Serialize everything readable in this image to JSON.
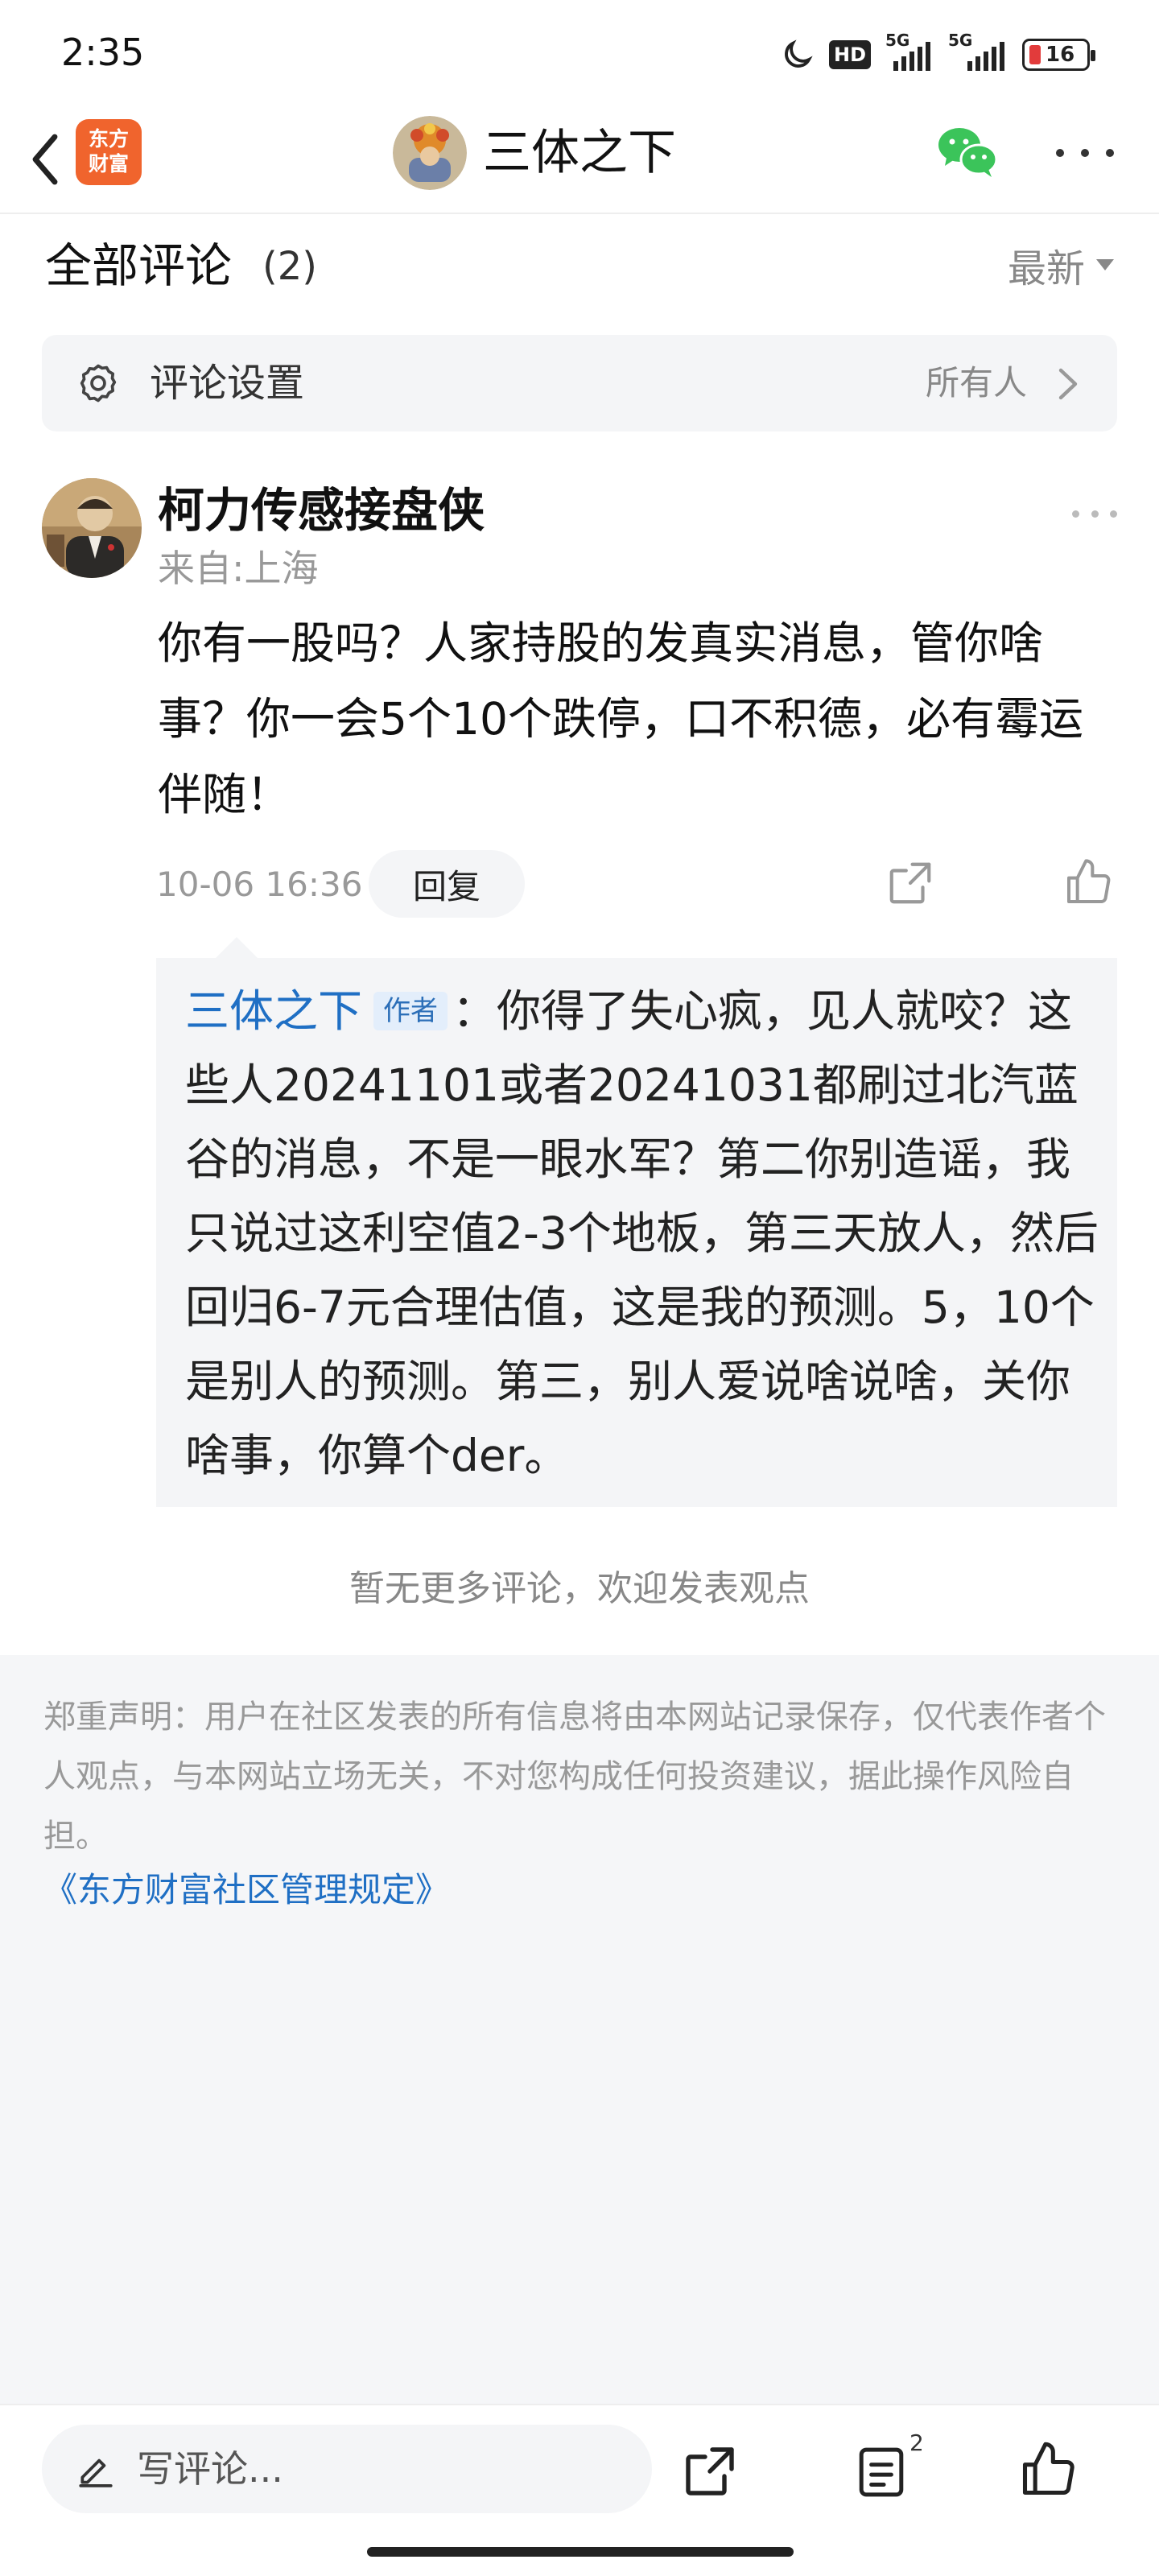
{
  "status_bar": {
    "time": "2:35",
    "hd_label": "HD",
    "net1_label": "5G",
    "net2_label": "5G",
    "battery_level": "16"
  },
  "header": {
    "logo_line1": "东方",
    "logo_line2": "财富",
    "title": "三体之下",
    "icons": {
      "back": "chevron-left-icon",
      "wechat": "wechat-icon",
      "more": "more-icon"
    },
    "logo_color": "#f0642d"
  },
  "comments": {
    "title": "全部评论",
    "count": "(2)",
    "sort_label": "最新"
  },
  "settings": {
    "label": "评论设置",
    "value": "所有人"
  },
  "comment": {
    "user_name": "柯力传感接盘侠",
    "location": "来自:上海",
    "text": "你有一股吗？人家持股的发真实消息，管你啥事？你一会5个10个跌停，口不积德，必有霉运伴随！",
    "time": "10-06 16:36",
    "reply_button": "回复"
  },
  "reply": {
    "author": "三体之下",
    "author_tag": "作者",
    "separator": "：",
    "text": "你得了失心疯，见人就咬？这些人20241101或者20241031都刷过北汽蓝谷的消息，不是一眼水军？第二你别造谣，我只说过这利空值2-3个地板，第三天放人，然后回归6-7元合理估值，这是我的预测。5，10个是别人的预测。第三，别人爱说啥说啥，关你啥事，你算个der。"
  },
  "no_more": "暂无更多评论，欢迎发表观点",
  "disclaimer": {
    "text": "郑重声明：用户在社区发表的所有信息将由本网站记录保存，仅代表作者个人观点，与本网站立场无关，不对您构成任何投资建议，据此操作风险自担。",
    "link": "《东方财富社区管理规定》"
  },
  "bottom_bar": {
    "placeholder": "写评论...",
    "comment_count": "2"
  },
  "colors": {
    "accent_blue": "#1f6fc4",
    "battery_low": "#e23b3b"
  }
}
